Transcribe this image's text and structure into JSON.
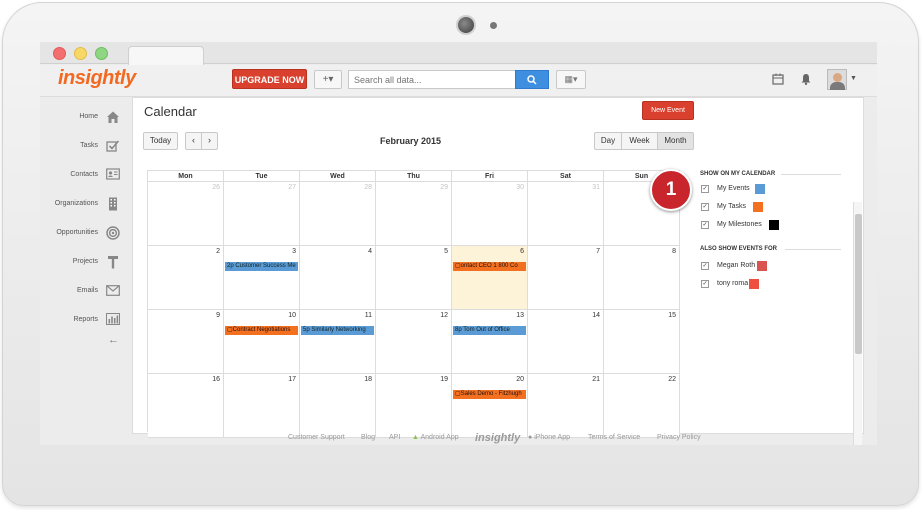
{
  "app": {
    "logo": "insightly",
    "upgrade_label": "UPGRADE NOW",
    "plus_label": "+▾",
    "search_placeholder": "Search all data...",
    "view_label": "▦▾"
  },
  "sidebar": {
    "items": [
      {
        "label": "Home",
        "icon": "home-icon"
      },
      {
        "label": "Tasks",
        "icon": "tasks-icon"
      },
      {
        "label": "Contacts",
        "icon": "contacts-icon"
      },
      {
        "label": "Organizations",
        "icon": "organizations-icon"
      },
      {
        "label": "Opportunities",
        "icon": "opportunities-icon"
      },
      {
        "label": "Projects",
        "icon": "projects-icon"
      },
      {
        "label": "Emails",
        "icon": "emails-icon"
      },
      {
        "label": "Reports",
        "icon": "reports-icon"
      }
    ]
  },
  "calendar": {
    "title": "Calendar",
    "new_event_label": "New Event",
    "today_label": "Today",
    "prev_label": "‹",
    "next_label": "›",
    "month_title": "February 2015",
    "views": [
      "Day",
      "Week",
      "Month"
    ],
    "active_view": "Month",
    "day_headers": [
      "Mon",
      "Tue",
      "Wed",
      "Thu",
      "Fri",
      "Sat",
      "Sun"
    ],
    "weeks": [
      [
        {
          "day": "26",
          "other": true
        },
        {
          "day": "27",
          "other": true
        },
        {
          "day": "28",
          "other": true
        },
        {
          "day": "29",
          "other": true
        },
        {
          "day": "30",
          "other": true
        },
        {
          "day": "31",
          "other": true
        },
        {
          "day": "1",
          "other": false
        }
      ],
      [
        {
          "day": "2"
        },
        {
          "day": "3",
          "event": {
            "text": "2p Customer Success Me",
            "color": "blue"
          }
        },
        {
          "day": "4"
        },
        {
          "day": "5"
        },
        {
          "day": "6",
          "today": true,
          "event": {
            "text": "▢ontact CEO 1 800 Co",
            "color": "orange"
          }
        },
        {
          "day": "7"
        },
        {
          "day": "8"
        }
      ],
      [
        {
          "day": "9"
        },
        {
          "day": "10",
          "event": {
            "text": "▢Contract Negotiations",
            "color": "orange"
          }
        },
        {
          "day": "11",
          "event": {
            "text": "5p Similarly Networking",
            "color": "blue"
          }
        },
        {
          "day": "12"
        },
        {
          "day": "13",
          "event": {
            "text": "8p Tom Out of Office",
            "color": "blue"
          }
        },
        {
          "day": "14"
        },
        {
          "day": "15"
        }
      ],
      [
        {
          "day": "16"
        },
        {
          "day": "17"
        },
        {
          "day": "18"
        },
        {
          "day": "19"
        },
        {
          "day": "20",
          "event": {
            "text": "▢Sales Demo - Fitzhugh",
            "color": "orange"
          }
        },
        {
          "day": "21"
        },
        {
          "day": "22"
        }
      ]
    ]
  },
  "right_panel": {
    "show_title": "SHOW ON MY CALENDAR",
    "show_items": [
      {
        "label": "My Events",
        "color": "#5a9bd5"
      },
      {
        "label": "My Tasks",
        "color": "#f37021"
      },
      {
        "label": "My Milestones",
        "color": "#000000"
      }
    ],
    "also_title": "ALSO SHOW EVENTS FOR",
    "also_items": [
      {
        "label": "Megan Roth",
        "color": "#d9534f"
      },
      {
        "label": "tony roma",
        "color": "#f04e3e"
      }
    ]
  },
  "badge": {
    "text": "1"
  },
  "footer": {
    "links": [
      "Customer Support",
      "Blog",
      "API",
      "Android App",
      "insightly",
      "iPhone App",
      "Terms of Service",
      "Privacy Policy"
    ]
  },
  "colors": {
    "brand_orange": "#f26a22",
    "action_red": "#d9412e",
    "search_blue": "#3f8fe0",
    "event_blue": "#5a9bd5",
    "event_orange": "#f37021",
    "badge_red": "#c8252c"
  }
}
